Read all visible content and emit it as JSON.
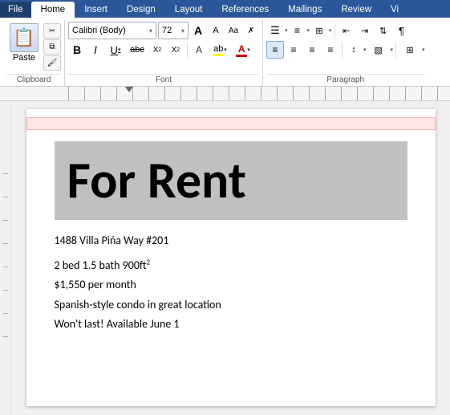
{
  "tabs": [
    {
      "label": "File",
      "active": false
    },
    {
      "label": "Home",
      "active": true
    },
    {
      "label": "Insert",
      "active": false
    },
    {
      "label": "Design",
      "active": false
    },
    {
      "label": "Layout",
      "active": false
    },
    {
      "label": "References",
      "active": false
    },
    {
      "label": "Mailings",
      "active": false
    },
    {
      "label": "Review",
      "active": false
    },
    {
      "label": "Vi",
      "active": false
    }
  ],
  "ribbon": {
    "clipboard": {
      "label": "Clipboard",
      "paste_label": "Paste",
      "cut_icon": "✂",
      "copy_icon": "⧉",
      "format_painter_icon": "🖌"
    },
    "font": {
      "label": "Font",
      "font_name": "Calibri (Body)",
      "font_size": "72",
      "grow_icon": "A",
      "shrink_icon": "A",
      "case_icon": "Aa",
      "clear_icon": "✗",
      "bold": "B",
      "italic": "I",
      "underline": "U",
      "strikethrough": "abc",
      "subscript": "X₂",
      "superscript": "X²",
      "font_color": "A",
      "highlight": "ab"
    },
    "paragraph": {
      "label": "Paragraph"
    }
  },
  "document": {
    "for_rent_text": "For Rent",
    "address": "1488 Villa Piña Way #201",
    "specs": "2 bed 1.5 bath 900ft",
    "specs_superscript": "2",
    "price": "$1,550 per month",
    "description1": "Spanish-style condo in great location",
    "description2": "Won't last! Available June 1"
  }
}
